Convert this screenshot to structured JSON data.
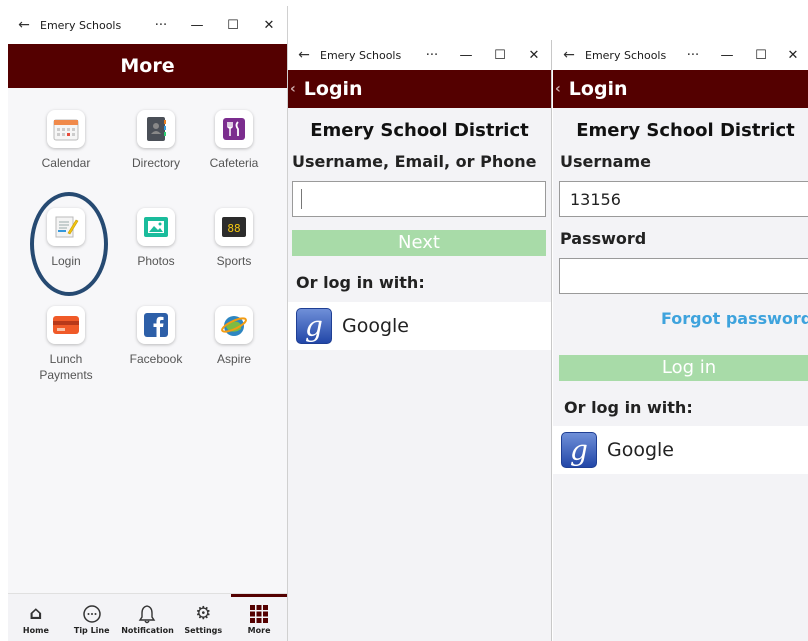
{
  "windows": {
    "more": {
      "title": "Emery Schools",
      "ctrl_more": "···",
      "ctrl_min": "—",
      "ctrl_max": "☐",
      "ctrl_close": "✕",
      "header": "More",
      "tiles": [
        {
          "label": "Calendar",
          "icon": "calendar-icon"
        },
        {
          "label": "Directory",
          "icon": "directory-icon"
        },
        {
          "label": "Cafeteria",
          "icon": "cafeteria-icon"
        },
        {
          "label": "Login",
          "icon": "login-icon"
        },
        {
          "label": "Photos",
          "icon": "photos-icon"
        },
        {
          "label": "Sports",
          "icon": "sports-icon"
        },
        {
          "label": "Lunch Payments",
          "icon": "lunch-payments-icon"
        },
        {
          "label": "Facebook",
          "icon": "facebook-icon"
        },
        {
          "label": "Aspire",
          "icon": "aspire-icon"
        }
      ],
      "tabs": [
        {
          "label": "Home",
          "icon": "home-icon"
        },
        {
          "label": "Tip Line",
          "icon": "tip-line-icon"
        },
        {
          "label": "Notification",
          "icon": "bell-icon"
        },
        {
          "label": "Settings",
          "icon": "gear-icon"
        },
        {
          "label": "More",
          "icon": "grid-icon"
        }
      ],
      "active_tab": "More"
    },
    "login1": {
      "title": "Emery Schools",
      "header": "Login",
      "district": "Emery School District",
      "field_label": "Username, Email, or Phone",
      "field_value": "",
      "next_label": "Next",
      "or_label": "Or log in with:",
      "google_label": "Google",
      "g_letter": "g"
    },
    "login2": {
      "title": "Emery Schools",
      "header": "Login",
      "district": "Emery School District",
      "username_label": "Username",
      "username_value": "13156",
      "password_label": "Password",
      "password_value": "",
      "forgot_label": "Forgot password?",
      "login_label": "Log in",
      "or_label": "Or log in with:",
      "google_label": "Google",
      "g_letter": "g"
    }
  },
  "colors": {
    "header_bg": "#540000",
    "button_bg": "#a8dba8",
    "link": "#3ea3dd",
    "highlight_circle": "#264a72"
  }
}
